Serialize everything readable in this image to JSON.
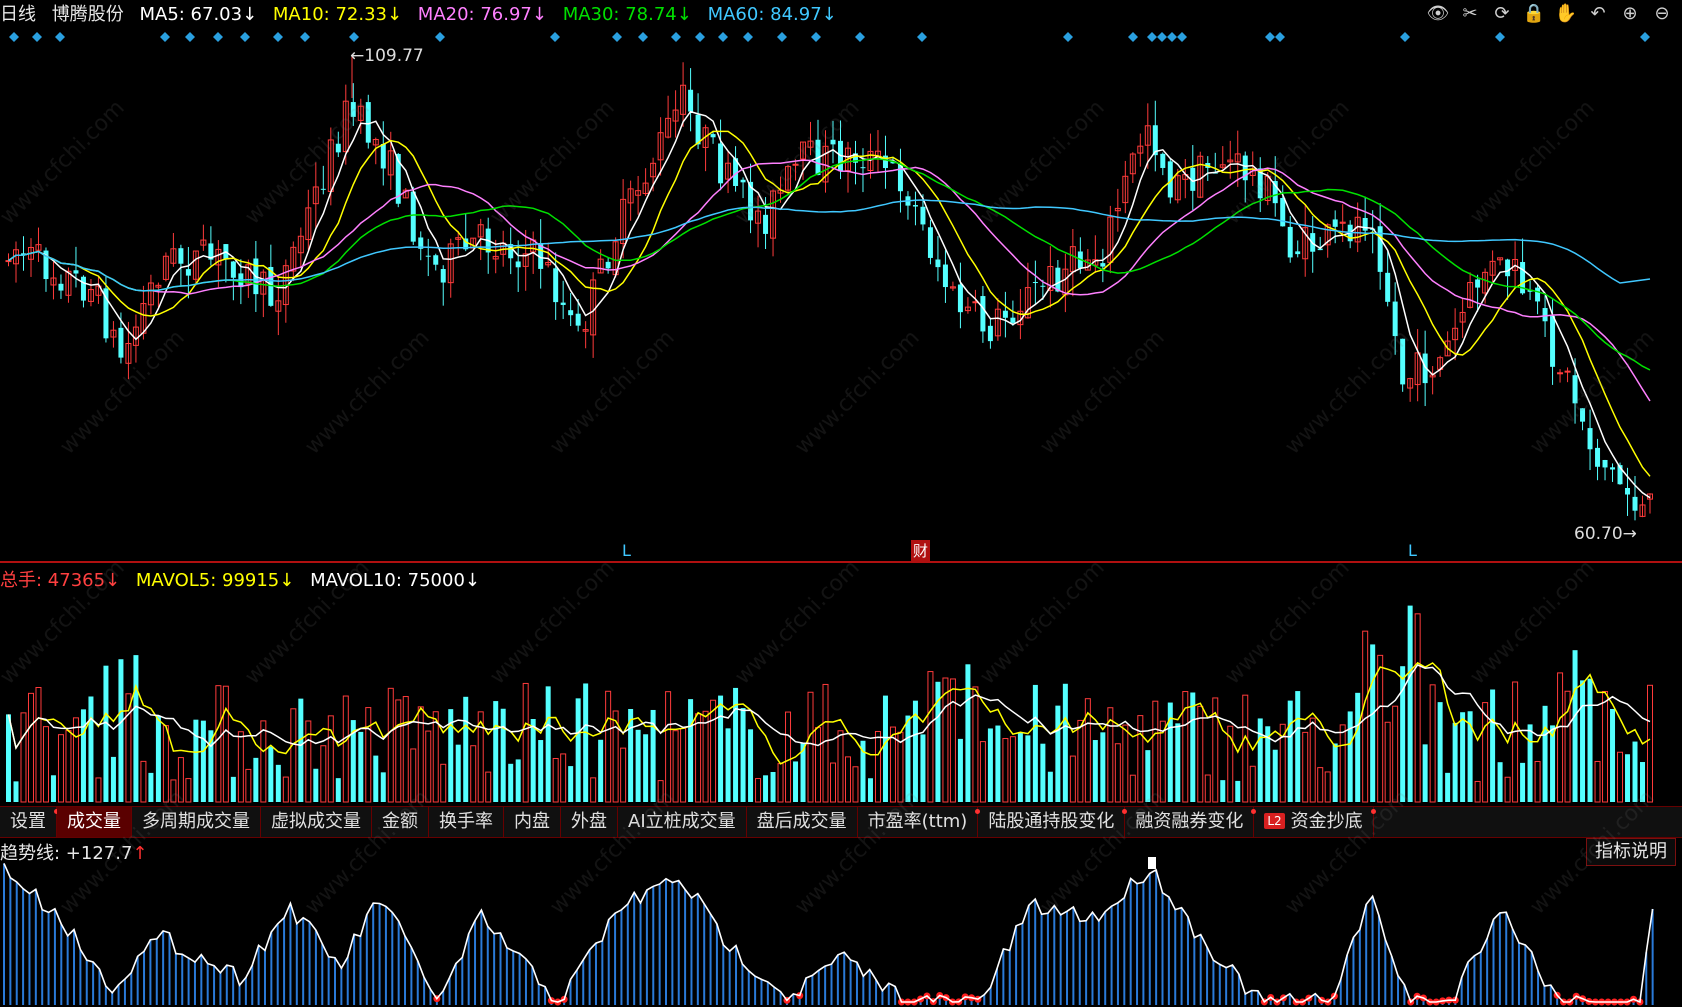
{
  "header": {
    "period": "日线",
    "stock_name": "博腾股份",
    "ma5": "MA5: 67.03↓",
    "ma10": "MA10: 72.33↓",
    "ma20": "MA20: 76.97↓",
    "ma30": "MA30: 78.74↓",
    "ma60": "MA60: 84.97↓"
  },
  "toolbar_icons": [
    "eye-icon",
    "scissors-icon",
    "replay-icon",
    "lock-icon",
    "hand-icon",
    "undo-icon",
    "zoom-in-icon",
    "zoom-out-icon"
  ],
  "price_chart": {
    "high_label": "109.77",
    "low_label": "60.70",
    "markers": [
      "L",
      "财",
      "L"
    ],
    "watermark": "www.cfchi.com"
  },
  "volume_header": {
    "total": "总手: 47365↓",
    "mavol5": "MAVOL5: 99915↓",
    "mavol10": "MAVOL10: 75000↓"
  },
  "tabs": [
    {
      "label": "设置",
      "dot": true
    },
    {
      "label": "成交量",
      "active": true
    },
    {
      "label": "多周期成交量"
    },
    {
      "label": "虚拟成交量"
    },
    {
      "label": "金额"
    },
    {
      "label": "换手率"
    },
    {
      "label": "内盘"
    },
    {
      "label": "外盘"
    },
    {
      "label": "AI立桩成交量"
    },
    {
      "label": "盘后成交量"
    },
    {
      "label": "市盈率(ttm)",
      "dot": true
    },
    {
      "label": "陆股通持股变化",
      "dot": true
    },
    {
      "label": "融资融券变化",
      "dot": true
    },
    {
      "label": "资金抄底",
      "dot": true,
      "badge": "L2"
    }
  ],
  "indicator": {
    "title": "趋势线: ",
    "value": "+127.7",
    "arrow": "↑",
    "explain_button": "指标说明"
  },
  "colors": {
    "up": "#ff3b3b",
    "down": "#54ffff",
    "ma5": "#ffffff",
    "ma10": "#ffff00",
    "ma20": "#ff80ff",
    "ma30": "#00e000",
    "ma60": "#40c8ff",
    "diamond": "#2aa0e0"
  }
}
